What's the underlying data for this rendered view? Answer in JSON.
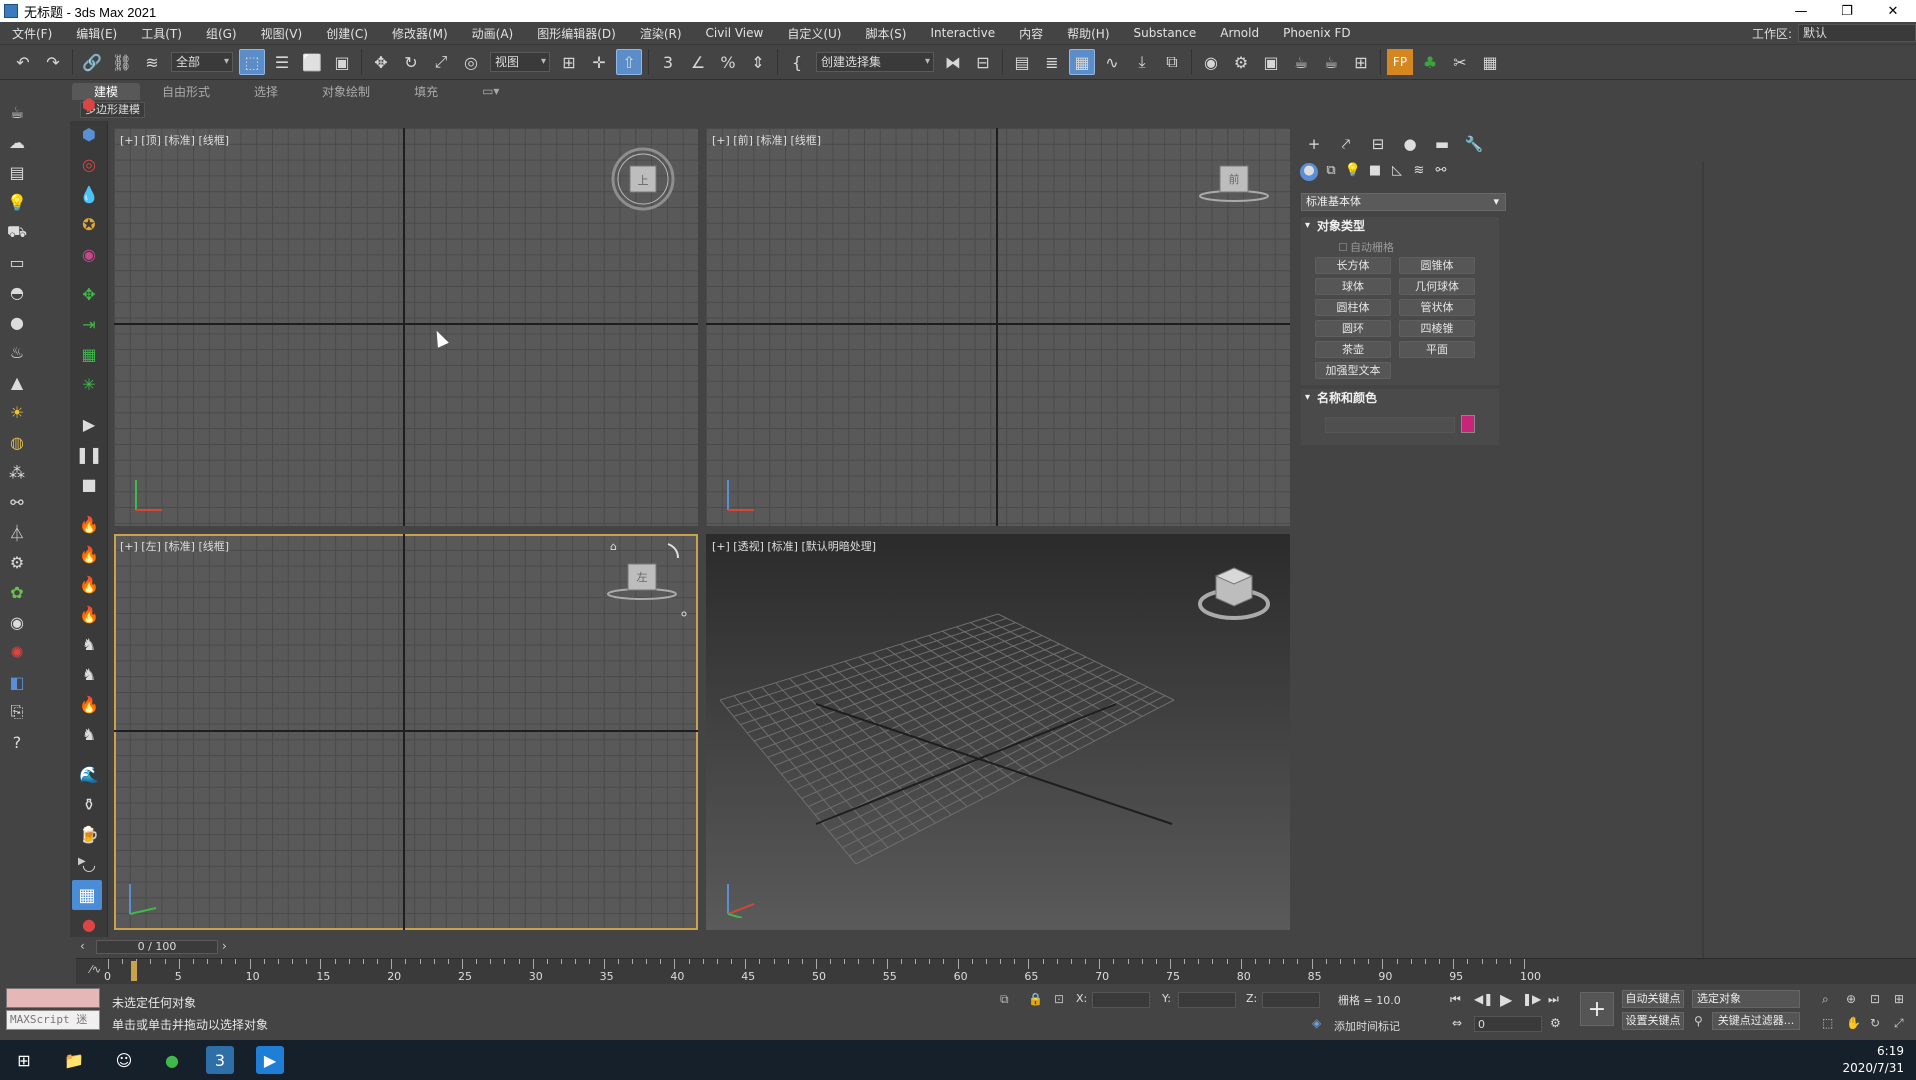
{
  "window": {
    "title": "无标题 - 3ds Max 2021",
    "minimize": "—",
    "restore": "❐",
    "close": "✕"
  },
  "menu": [
    "文件(F)",
    "编辑(E)",
    "工具(T)",
    "组(G)",
    "视图(V)",
    "创建(C)",
    "修改器(M)",
    "动画(A)",
    "图形编辑器(D)",
    "渲染(R)",
    "Civil View",
    "自定义(U)",
    "脚本(S)",
    "Interactive",
    "内容",
    "帮助(H)",
    "Substance",
    "Arnold",
    "Phoenix FD"
  ],
  "workspace": {
    "label": "工作区:",
    "value": "默认"
  },
  "toolbar": {
    "filter_dropdown": "全部",
    "ref_coord_dropdown": "视图",
    "selection_set_dropdown": "创建选择集",
    "icons": [
      "undo-icon",
      "redo-icon",
      "link-icon",
      "unlink-icon",
      "bind-spacewarp-icon",
      "select-object-icon",
      "select-by-name-icon",
      "rect-selection-icon",
      "window-crossing-icon",
      "move-icon",
      "rotate-icon",
      "scale-icon",
      "placement-icon",
      "pivot-icon",
      "select-manipulate-icon",
      "snap-3d-icon",
      "angle-snap-icon",
      "percent-snap-icon",
      "spinner-snap-icon",
      "edit-named-sel-icon",
      "mirror-icon",
      "align-icon",
      "layer-explorer-icon",
      "toggle-ribbon-icon",
      "curve-editor-icon",
      "schematic-view-icon",
      "material-editor-icon",
      "render-setup-icon",
      "rendered-frame-icon",
      "render-production-icon",
      "render-iterative-icon",
      "arnold-icon",
      "phoenix-icon"
    ]
  },
  "ribbon": {
    "tabs": [
      "建模",
      "自由形式",
      "选择",
      "对象绘制",
      "填充"
    ],
    "active": "建模",
    "subtab": "多边形建模"
  },
  "viewports": [
    {
      "id": "top",
      "label": "[+] [顶] [标准] [线框]",
      "cube_face": "上"
    },
    {
      "id": "front",
      "label": "[+] [前] [标准] [线框]",
      "cube_face": "前"
    },
    {
      "id": "left",
      "label": "[+] [左] [标准] [线框]",
      "cube_face": "左"
    },
    {
      "id": "persp",
      "label": "[+] [透视] [标准] [默认明暗处理]",
      "cube_face": ""
    }
  ],
  "command_panel": {
    "category": "标准基本体",
    "object_type_title": "对象类型",
    "autogrid": "自动栅格",
    "buttons": [
      "长方体",
      "圆锥体",
      "球体",
      "几何球体",
      "圆柱体",
      "管状体",
      "圆环",
      "四棱锥",
      "茶壶",
      "平面",
      "加强型文本"
    ],
    "name_color_title": "名称和颜色",
    "color": "#c8247a"
  },
  "timeline": {
    "position": "0 / 100",
    "ticks": [
      0,
      5,
      10,
      15,
      20,
      25,
      30,
      35,
      40,
      45,
      50,
      55,
      60,
      65,
      70,
      75,
      80,
      85,
      90,
      95,
      100
    ]
  },
  "status": {
    "maxscript": "MAXScript 迷",
    "line1": "未选定任何对象",
    "line2": "单击或单击并拖动以选择对象",
    "x_label": "X:",
    "y_label": "Y:",
    "z_label": "Z:",
    "grid": "栅格 = 10.0",
    "add_time_tag": "添加时间标记",
    "auto_key": "自动关键点",
    "set_key": "设置关键点",
    "selected_dropdown": "选定对象",
    "key_filters": "关键点过滤器...",
    "frame": "0"
  },
  "taskbar": {
    "time": "6:19",
    "date": "2020/7/31"
  }
}
